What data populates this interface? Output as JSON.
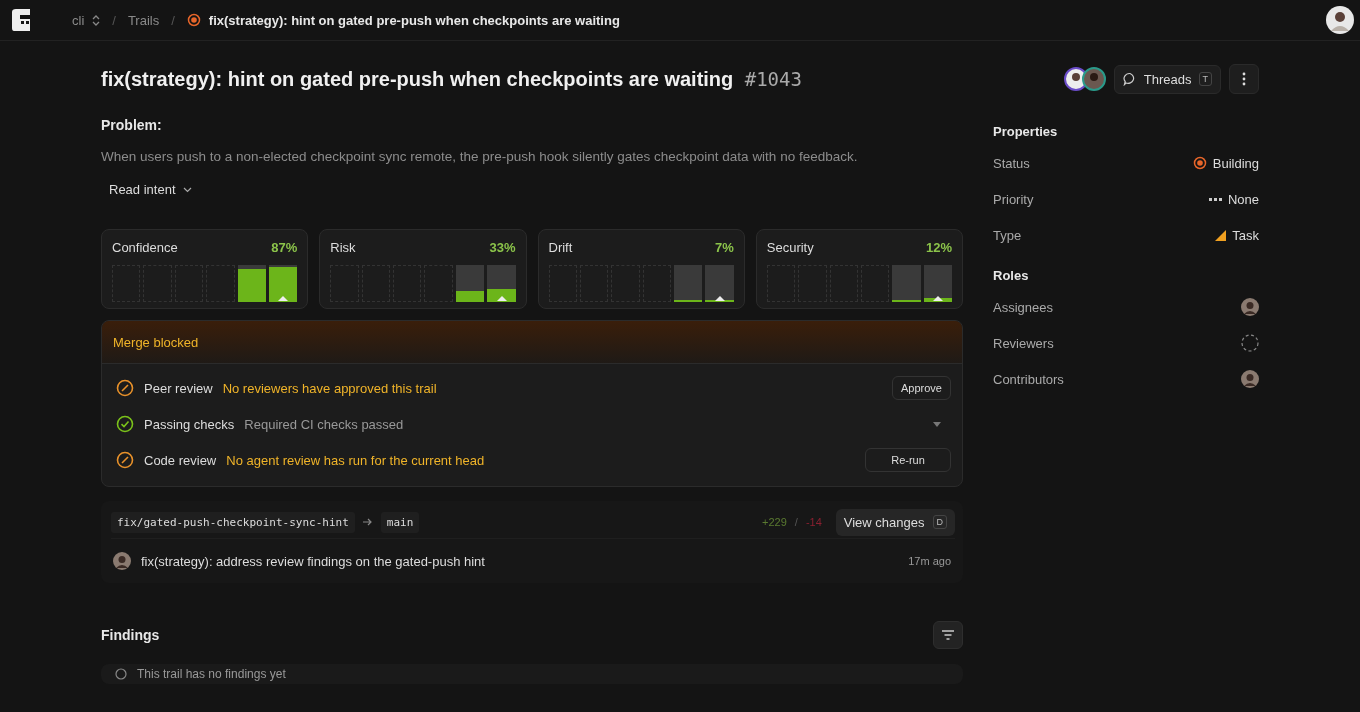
{
  "breadcrumb": {
    "project": "cli",
    "separators": [
      "/",
      "/"
    ],
    "section": "Trails",
    "current": "fix(strategy): hint on gated pre-push when checkpoints are waiting"
  },
  "header": {
    "title": "fix(strategy): hint on gated pre-push when checkpoints are waiting",
    "number": "#1043",
    "threads_button": "Threads",
    "threads_key": "T"
  },
  "problem": {
    "heading": "Problem:",
    "text": "When users push to a non-elected checkpoint sync remote, the pre-push hook silently gates checkpoint data with no feedback.",
    "toggle": "Read intent"
  },
  "metrics": [
    {
      "label": "Confidence",
      "value": "87%",
      "bars": [
        {
          "level": 0.9
        },
        {
          "level": 0.95
        }
      ]
    },
    {
      "label": "Risk",
      "value": "33%",
      "bars": [
        {
          "level": 0.3
        },
        {
          "level": 0.35
        }
      ]
    },
    {
      "label": "Drift",
      "value": "7%",
      "bars": [
        {
          "level": 0.05
        },
        {
          "level": 0.05
        }
      ]
    },
    {
      "label": "Security",
      "value": "12%",
      "bars": [
        {
          "level": 0.06
        },
        {
          "level": 0.1
        }
      ]
    }
  ],
  "merge": {
    "title": "Merge blocked",
    "checks": [
      {
        "name": "Peer review",
        "kind": "blocked",
        "message": "No reviewers have approved this trail",
        "action": "Approve"
      },
      {
        "name": "Passing checks",
        "kind": "passed",
        "message": "Required CI checks passed"
      },
      {
        "name": "Code review",
        "kind": "blocked",
        "message": "No agent review has run for the current head",
        "action": "Re-run"
      }
    ]
  },
  "branch": {
    "source": "fix/gated-push-checkpoint-sync-hint",
    "target": "main",
    "additions": "+229",
    "separator": "/",
    "deletions": "-14",
    "view_button": "View changes",
    "view_key": "D"
  },
  "commit": {
    "message": "fix(strategy): address review findings on the gated-push hint",
    "time": "17m ago"
  },
  "findings": {
    "heading": "Findings",
    "empty": "This trail has no findings yet"
  },
  "properties": {
    "heading": "Properties",
    "rows": [
      {
        "label": "Status",
        "value": "Building",
        "kind": "status"
      },
      {
        "label": "Priority",
        "value": "None",
        "kind": "priority"
      },
      {
        "label": "Type",
        "value": "Task",
        "kind": "type"
      }
    ]
  },
  "roles": {
    "heading": "Roles",
    "rows": [
      {
        "label": "Assignees",
        "kind": "avatar"
      },
      {
        "label": "Reviewers",
        "kind": "empty"
      },
      {
        "label": "Contributors",
        "kind": "avatar"
      }
    ]
  }
}
